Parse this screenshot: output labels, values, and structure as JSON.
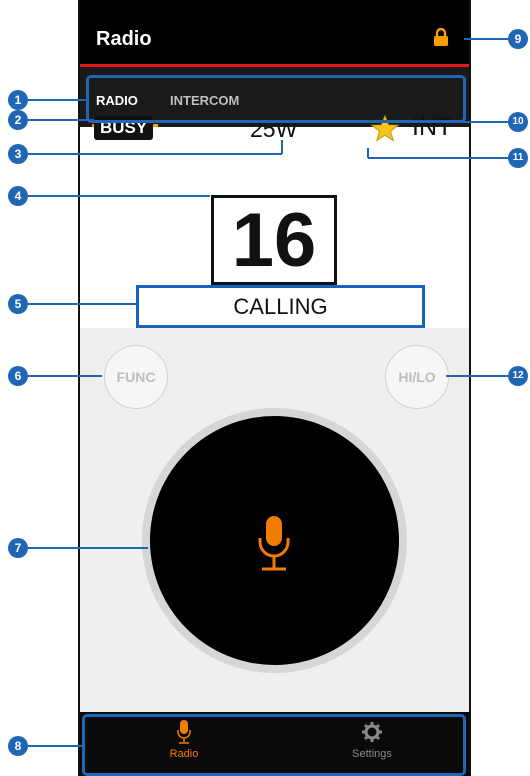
{
  "appbar": {
    "title": "Radio",
    "lock_icon": "lock-icon",
    "accent": "#e4181c"
  },
  "tabs": [
    {
      "label": "RADIO"
    },
    {
      "label": "INTERCOM"
    }
  ],
  "status": {
    "busy": "BUSY",
    "power": "25W",
    "favorite_icon": "star-icon",
    "channel_type": "INT",
    "channel": "16",
    "call_status": "CALLING"
  },
  "controls": {
    "func_label": "FUNC",
    "hilo_label": "HI/LO",
    "ptt_icon": "microphone-icon"
  },
  "bottom_nav": [
    {
      "label": "Radio",
      "icon": "microphone-icon",
      "color": "#f07d00"
    },
    {
      "label": "Settings",
      "icon": "gear-icon",
      "color": "#8a8a8a"
    }
  ],
  "callouts": [
    "1",
    "2",
    "3",
    "4",
    "5",
    "6",
    "7",
    "8",
    "9",
    "10",
    "11",
    "12"
  ]
}
